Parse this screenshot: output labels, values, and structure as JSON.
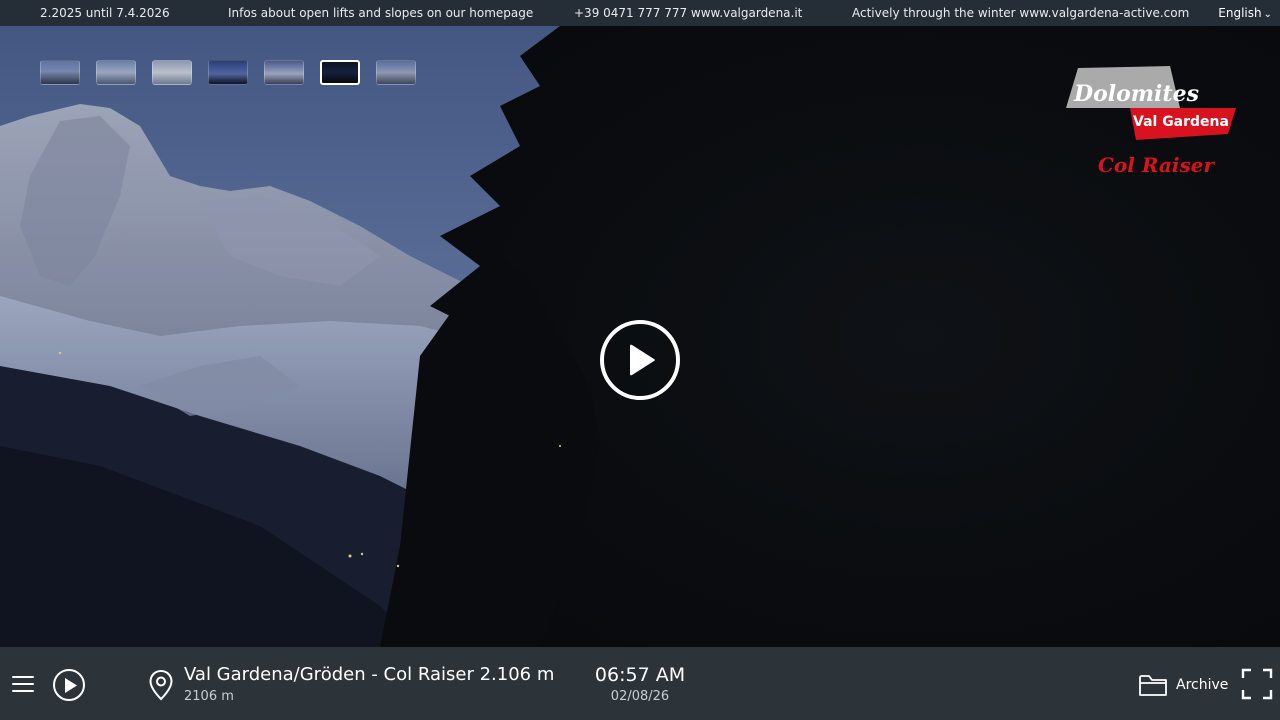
{
  "ticker": {
    "items": [
      "2.2025 until 7.4.2026",
      "Infos about open lifts and slopes on our homepage",
      "+39 0471 777 777 www.valgardena.it",
      "Actively through the winter www.valgardena-active.com"
    ],
    "language": "English"
  },
  "thumbnails": {
    "count": 7,
    "active_index": 5
  },
  "logo": {
    "line1": "Dolomites",
    "line2": "Val Gardena",
    "line3": "Col Raiser"
  },
  "location": {
    "title": "Val Gardena/Gröden - Col Raiser 2.106 m",
    "altitude": "2106 m"
  },
  "clock": {
    "time": "06:57 AM",
    "date": "02/08/26"
  },
  "archive": {
    "label": "Archive"
  },
  "icons": {
    "menu": "hamburger-icon",
    "play": "play-icon",
    "location": "map-pin-icon",
    "archive": "folder-icon",
    "fullscreen": "fullscreen-icon",
    "language": "chevron-down-icon"
  },
  "colors": {
    "bar_bg": "#2c3339",
    "ticker_bg": "#28303a",
    "logo_red": "#d8121e",
    "logo_grey": "#b8b8b8"
  }
}
